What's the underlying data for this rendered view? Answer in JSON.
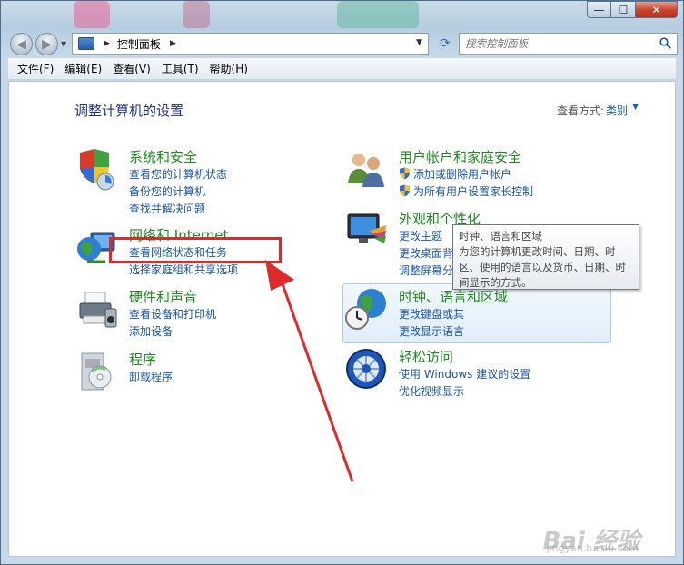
{
  "window": {
    "caption_buttons": {
      "minimize": "—",
      "maximize": "☐",
      "close": "✕"
    }
  },
  "navbar": {
    "back_icon": "back-arrow-icon",
    "forward_icon": "forward-arrow-icon",
    "address_text": "控制面板",
    "search_placeholder": "搜索控制面板"
  },
  "menubar": {
    "items": [
      "文件(F)",
      "编辑(E)",
      "查看(V)",
      "工具(T)",
      "帮助(H)"
    ]
  },
  "content": {
    "title": "调整计算机的设置",
    "view_by_label": "查看方式:",
    "view_by_value": "类别",
    "categories": [
      {
        "title": "系统和安全",
        "icon": "system-security-shield-icon",
        "links": [
          "查看您的计算机状态",
          "备份您的计算机",
          "查找并解决问题"
        ]
      },
      {
        "title": "网络和 Internet",
        "icon": "network-globe-icon",
        "links": [
          "查看网络状态和任务",
          "选择家庭组和共享选项"
        ]
      },
      {
        "title": "硬件和声音",
        "icon": "printer-icon",
        "links": [
          "查看设备和打印机",
          "添加设备"
        ]
      },
      {
        "title": "程序",
        "icon": "programs-disc-icon",
        "links": [
          "卸载程序"
        ]
      },
      {
        "title": "用户帐户和家庭安全",
        "icon": "users-icon",
        "links": [
          "添加或删除用户帐户",
          "为所有用户设置家长控制"
        ]
      },
      {
        "title": "外观和个性化",
        "icon": "appearance-monitor-icon",
        "links": [
          "更改主题",
          "更改桌面背景",
          "调整屏幕分辨率"
        ]
      },
      {
        "title": "时钟、语言和区域",
        "icon": "clock-globe-icon",
        "links": [
          "更改键盘或其",
          "更改显示语言"
        ]
      },
      {
        "title": "轻松访问",
        "icon": "ease-of-access-icon",
        "links": [
          "使用 Windows 建议的设置",
          "优化视频显示"
        ]
      }
    ],
    "tooltip": {
      "title": "时钟、语言和区域",
      "body": "为您的计算机更改时间、日期、时区、使用的语言以及货币、日期、时间显示的方式。"
    }
  },
  "watermark": {
    "logo": "Bai 经验",
    "url": "jingyan.baidu.com"
  },
  "colors": {
    "title_blue": "#1e3287",
    "category_green": "#1f8a1f",
    "link_blue": "#1b56a6",
    "annotation_red": "#e02a2a"
  }
}
